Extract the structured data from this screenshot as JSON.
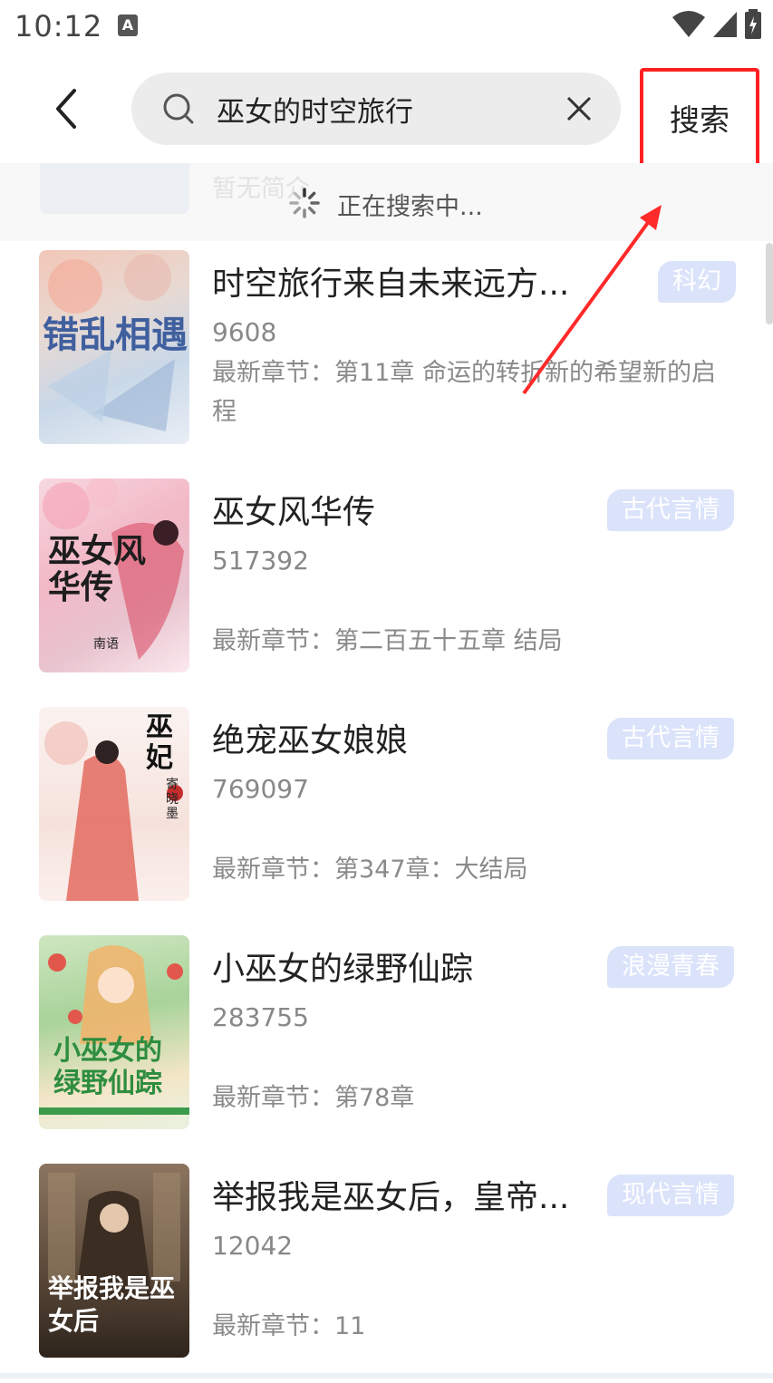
{
  "status_bar": {
    "time": "10:12",
    "indicator": "A"
  },
  "search": {
    "query": "巫女的时空旅行",
    "button_label": "搜索"
  },
  "loading": {
    "text": "正在搜索中...",
    "ghost_intro": "暂无简介"
  },
  "books": [
    {
      "title": "时空旅行来自未来远方...",
      "count": "9608",
      "latest": "最新章节：第11章 命运的转折新的希望新的启程",
      "tag": "科幻",
      "cover_caption": "错乱相遇"
    },
    {
      "title": "巫女风华传",
      "count": "517392",
      "latest": "最新章节：第二百五十五章 结局",
      "tag": "古代言情",
      "cover_caption": "巫女风华传",
      "cover_author": "南语"
    },
    {
      "title": "绝宠巫女娘娘",
      "count": "769097",
      "latest": "最新章节：第347章：大结局",
      "tag": "古代言情",
      "cover_caption": "巫妃",
      "cover_author": "寄晓墨"
    },
    {
      "title": "小巫女的绿野仙踪",
      "count": "283755",
      "latest": "最新章节：第78章",
      "tag": "浪漫青春",
      "cover_caption": "小巫女的绿野仙踪"
    },
    {
      "title": "举报我是巫女后，皇帝...",
      "count": "12042",
      "latest": "最新章节：11",
      "tag": "现代言情",
      "cover_caption": "举报我是巫女后"
    }
  ],
  "colors": {
    "highlight": "#ff2020",
    "tag_bg": "#dbe3fb",
    "search_bg": "#ececec"
  },
  "icons": [
    "back-arrow-icon",
    "search-icon",
    "clear-icon",
    "loading-spinner-icon",
    "wifi-icon",
    "signal-icon",
    "battery-icon"
  ]
}
